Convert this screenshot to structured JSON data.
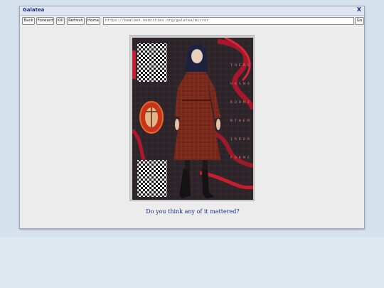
{
  "window": {
    "title": "Galatea",
    "close_label": "X"
  },
  "toolbar": {
    "back": "Back",
    "forward": "Forward",
    "kill": "Kill",
    "refresh": "Refresh",
    "home": "Home",
    "url": "https://baalbek.neocities.org/galatea/mirror",
    "go": "Go"
  },
  "content": {
    "caption": "Do you think any of it mattered?",
    "side_text": [
      "T",
      "H",
      "E",
      "R",
      "E",
      "U",
      "A",
      "S",
      "N",
      "O",
      "R",
      "O",
      "O",
      "M",
      "I",
      "N",
      "T",
      "H",
      "E",
      "M",
      "I",
      "R",
      "R",
      "O",
      "R",
      "F",
      "O",
      "R",
      "M",
      "E"
    ]
  },
  "colors": {
    "accent": "#1a2a8a",
    "dress": "#7a2a1c",
    "background_art": "#2a2328"
  }
}
